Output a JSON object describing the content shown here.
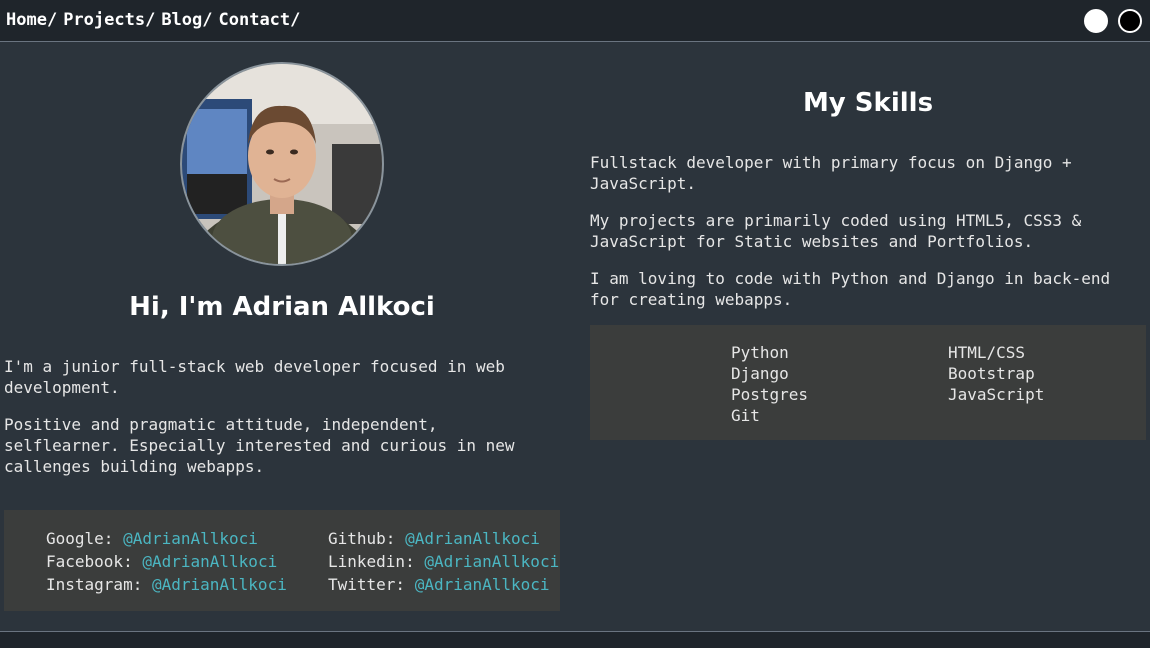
{
  "nav": {
    "breadcrumbs": [
      "Home/",
      "Projects/",
      "Blog/",
      "Contact/"
    ]
  },
  "profile": {
    "heading": "Hi, I'm Adrian Allkoci",
    "paragraphs": [
      "I'm a junior full-stack web developer focused in web development.",
      "Positive and pragmatic attitude, independent, selflearner. Especially interested and curious in new callenges building webapps."
    ]
  },
  "contacts": {
    "col1": [
      {
        "label": "Google:",
        "handle": "@AdrianAllkoci"
      },
      {
        "label": "Facebook:",
        "handle": "@AdrianAllkoci"
      },
      {
        "label": "Instagram:",
        "handle": "@AdrianAllkoci"
      }
    ],
    "col2": [
      {
        "label": "Github:",
        "handle": "@AdrianAllkoci"
      },
      {
        "label": "Linkedin:",
        "handle": "@AdrianAllkoci"
      },
      {
        "label": "Twitter:",
        "handle": "@AdrianAllkoci"
      }
    ]
  },
  "skills": {
    "heading": "My Skills",
    "paragraphs": [
      "Fullstack developer with primary focus on Django + JavaScript.",
      "My projects are primarily coded using HTML5, CSS3 & JavaScript for Static websites and Portfolios.",
      "I am loving to code with Python and Django in back-end for creating webapps."
    ],
    "col1": [
      "Python",
      "Django",
      "Postgres",
      "Git"
    ],
    "col2": [
      "HTML/CSS",
      "Bootstrap",
      "JavaScript"
    ]
  },
  "colors": {
    "background": "#2c343c",
    "topbar": "#1f252b",
    "box": "#3b3d3c",
    "link": "#4bb6c2"
  }
}
